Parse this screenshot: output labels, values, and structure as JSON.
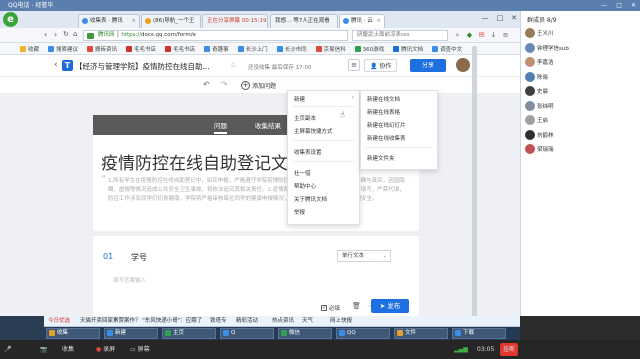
{
  "window": {
    "title": "QQ电话 - 经管毕",
    "controls": [
      "—",
      "□",
      "✕"
    ]
  },
  "browser": {
    "tabs": [
      {
        "label": "收集表 · 腾讯",
        "color": "#3a8ee6",
        "active": false
      },
      {
        "label": "(86)导航_一个王",
        "color": "#f0a020",
        "active": false
      },
      {
        "label": "正在分享屏幕   00:15:19",
        "color": "#e04a3a",
        "active": false
      },
      {
        "label": "我想… 等7人正在观看",
        "color": "#3a8ee6",
        "active": false
      },
      {
        "label": "腾讯 · 云",
        "color": "#3a8ee6",
        "active": true
      }
    ],
    "win_controls": [
      "—",
      "□",
      "✕"
    ],
    "url_prefix": "https://",
    "url": "docs.qq.com/form/e",
    "url_label": "腾讯网",
    "search_placeholder": "研腹武士面前凉表sss",
    "bookmarks": [
      {
        "label": "收藏",
        "color": "#f0b030"
      },
      {
        "label": "搜索建议",
        "color": "#3a8ee6"
      },
      {
        "label": "搬砖资讯",
        "color": "#e04a3a"
      },
      {
        "label": "毛毛书店",
        "color": "#d03030"
      },
      {
        "label": "毛毛书店",
        "color": "#d03030"
      },
      {
        "label": "奇趣事",
        "color": "#3a8ee6"
      },
      {
        "label": "长沙上门",
        "color": "#3a8ee6"
      },
      {
        "label": "长沙市同",
        "color": "#3a8ee6"
      },
      {
        "label": "京易信科",
        "color": "#e04a3a"
      },
      {
        "label": "360游戏",
        "color": "#30a050"
      },
      {
        "label": "腾讯文档",
        "color": "#1b6ed6"
      },
      {
        "label": "调查中文",
        "color": "#3a8ee6"
      }
    ]
  },
  "doc": {
    "title": "【经济与管理学院】疫情防控在线自助...",
    "status": "还没收集   最后保存 17:00",
    "collab_label": "协作",
    "share_label": "分享",
    "toolbar": {
      "add_question": "添加问题"
    },
    "form_tabs": [
      "问题",
      "收集结果"
    ],
    "form_title": "疫情防控在线自助登记文",
    "form_desc": "1.所有学生在疫情防控在线自助登记中，如实申报，严格遵守学院疫情防控各项要求，确保填写信息的准确与真实，因因隐瞒、虚报等情况造成公共安全卫生事故，将依法追究其相关责任。2.疫情防控期间，请各位同学每日按时填写，严禁代填，防控工作涉及同学们切身健康，学院将严格审核每位同学的健康申报情况，希望大家重视，共同守护校园安全。",
    "question": {
      "number": "01",
      "title": "学号",
      "type_label": "单行文本",
      "placeholder": "填写答案输入",
      "required_label": "必填",
      "publish_label": "发布"
    }
  },
  "menus": {
    "new_menu": {
      "header": "新建",
      "groups": [
        [
          "主页副本",
          "主屏幕快捷方式"
        ],
        [
          "收集表设置"
        ],
        [
          "社一惜",
          "帮助中心",
          "关于腾讯文档",
          "举报"
        ]
      ]
    },
    "new_submenu": [
      "新建在线文档",
      "新建在线表格",
      "新建在线幻灯片",
      "新建在线收集表",
      "新建文件夹"
    ]
  },
  "members": {
    "title": "群成员 8/9",
    "list": [
      {
        "name": "王义川",
        "color": "#9a7a5a"
      },
      {
        "name": "钟理学信sub",
        "color": "#6a8ab0"
      },
      {
        "name": "李嘉浩",
        "color": "#c09070"
      },
      {
        "name": "陈晓",
        "color": "#5080b0"
      },
      {
        "name": "史晨",
        "color": "#404040"
      },
      {
        "name": "张纬明",
        "color": "#8090a0"
      },
      {
        "name": "王启",
        "color": "#a0a0a0"
      },
      {
        "name": "刘鹤林",
        "color": "#303030"
      },
      {
        "name": "梁瑞瑞",
        "color": "#c05050"
      }
    ]
  },
  "taskbar": {
    "ticker": [
      "今日优选",
      "天猫开卖回家累赘案作？ \"东风快递小哥\"：应聘了",
      "铁塔专",
      "精彩活动",
      "热点资讯",
      "天气",
      "网上快报"
    ],
    "items": [
      {
        "label": "收集",
        "color": "#e0a030"
      },
      {
        "label": "新建",
        "color": "#3a8ee6"
      },
      {
        "label": "主页",
        "color": "#30a050"
      },
      {
        "label": "Q",
        "color": "#3a8ee6"
      },
      {
        "label": "微信",
        "color": "#30a050"
      },
      {
        "label": "QQ",
        "color": "#3a8ee6"
      },
      {
        "label": "文件",
        "color": "#e0a030"
      },
      {
        "label": "下载",
        "color": "#3a8ee6"
      }
    ]
  },
  "call": {
    "hold_label": "收集",
    "screen_label": "录屏",
    "share_label": "共享",
    "more_label": "屏幕",
    "timer": "03:05",
    "hangup": "挂断"
  }
}
